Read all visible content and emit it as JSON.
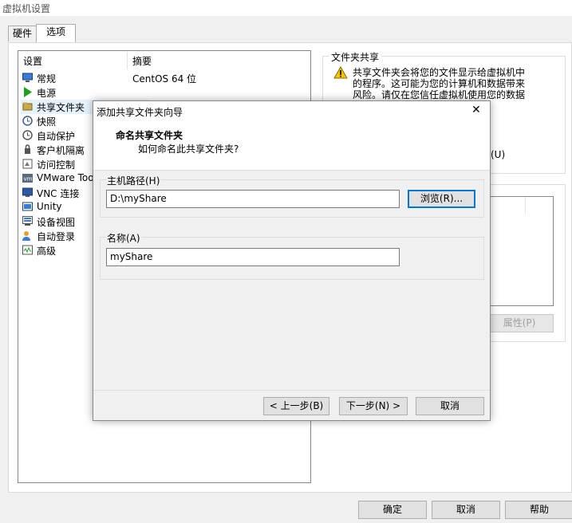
{
  "window": {
    "title": "虚拟机设置"
  },
  "tabs": [
    {
      "label": "硬件"
    },
    {
      "label": "选项"
    }
  ],
  "list": {
    "header": {
      "settings": "设置",
      "summary": "摘要"
    },
    "items": [
      {
        "label": "常规",
        "summary": "CentOS 64 位",
        "icon": "monitor-icon"
      },
      {
        "label": "电源",
        "summary": "",
        "icon": "power-play-icon"
      },
      {
        "label": "共享文件夹",
        "summary": "",
        "icon": "shared-folder-icon"
      },
      {
        "label": "快照",
        "summary": "",
        "icon": "snapshot-icon"
      },
      {
        "label": "自动保护",
        "summary": "",
        "icon": "autoprotect-icon"
      },
      {
        "label": "客户机隔离",
        "summary": "",
        "icon": "isolation-icon"
      },
      {
        "label": "访问控制",
        "summary": "",
        "icon": "access-control-icon"
      },
      {
        "label": "VMware Too",
        "summary": "",
        "icon": "vmware-tools-icon"
      },
      {
        "label": "VNC 连接",
        "summary": "",
        "icon": "vnc-icon"
      },
      {
        "label": "Unity",
        "summary": "",
        "icon": "unity-icon"
      },
      {
        "label": "设备视图",
        "summary": "",
        "icon": "device-view-icon"
      },
      {
        "label": "自动登录",
        "summary": "",
        "icon": "autologin-icon"
      },
      {
        "label": "高级",
        "summary": "",
        "icon": "advanced-icon"
      }
    ]
  },
  "right": {
    "group_title": "文件夹共享",
    "warning_lines": [
      "共享文件夹会将您的文件显示给虚拟机中",
      "的程序。这可能为您的计算机和数据带来",
      "风险。请仅在您信任虚拟机使用您的数据"
    ],
    "option_suffix": "(U)",
    "properties_button": "属性(P)"
  },
  "footer": {
    "ok": "确定",
    "cancel": "取消",
    "help": "帮助"
  },
  "dialog": {
    "title": "添加共享文件夹向导",
    "heading": "命名共享文件夹",
    "subheading": "如何命名此共享文件夹?",
    "host_path_label": "主机路径(H)",
    "host_path_value": "D:\\myShare",
    "browse_button": "浏览(R)...",
    "name_label": "名称(A)",
    "name_value": "myShare",
    "back_button": "< 上一步(B)",
    "next_button": "下一步(N) >",
    "cancel_button": "取消",
    "close_glyph": "✕"
  },
  "colors": {
    "accent": "#0078d7",
    "warning": "#f5c400",
    "power_green": "#20a020"
  }
}
